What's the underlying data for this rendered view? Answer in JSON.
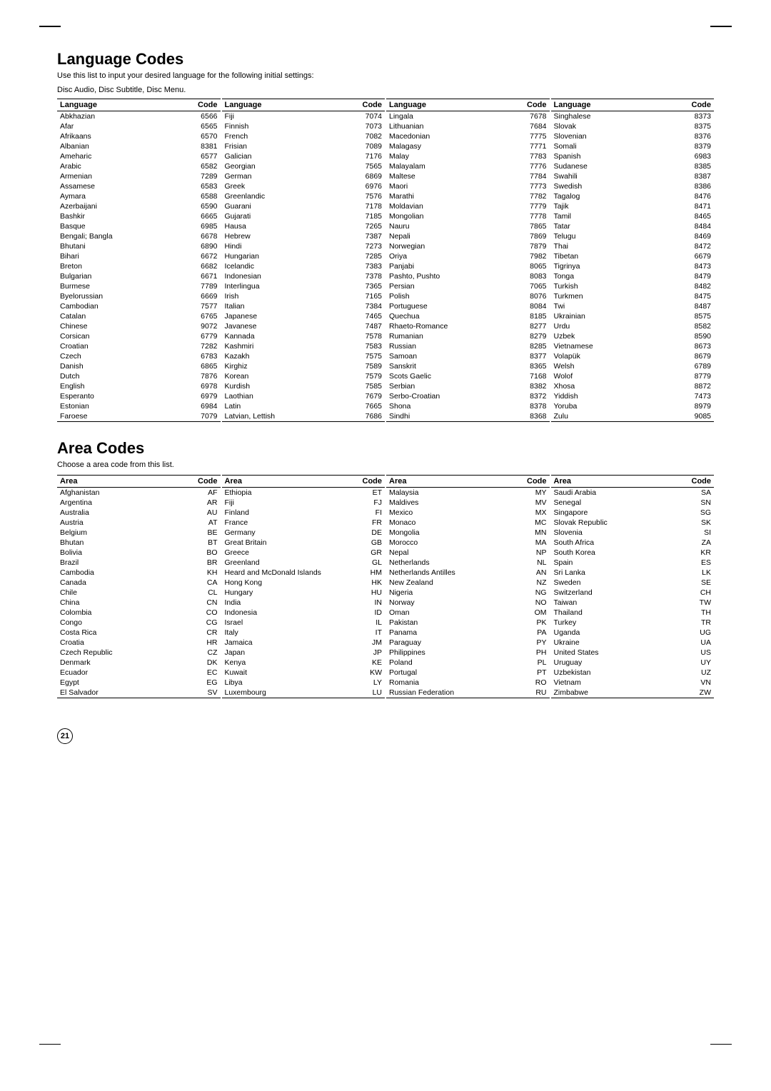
{
  "page": {
    "number": "21",
    "language_section": {
      "title": "Language Codes",
      "desc1": "Use this list to input your desired language for the following initial settings:",
      "desc2": "Disc Audio, Disc Subtitle, Disc Menu."
    },
    "area_section": {
      "title": "Area Codes",
      "desc": "Choose a area code from this list."
    }
  },
  "language_columns": [
    {
      "header_lang": "Language",
      "header_code": "Code",
      "rows": [
        [
          "Abkhazian",
          "6566"
        ],
        [
          "Afar",
          "6565"
        ],
        [
          "Afrikaans",
          "6570"
        ],
        [
          "Albanian",
          "8381"
        ],
        [
          "Ameharic",
          "6577"
        ],
        [
          "Arabic",
          "6582"
        ],
        [
          "Armenian",
          "7289"
        ],
        [
          "Assamese",
          "6583"
        ],
        [
          "Aymara",
          "6588"
        ],
        [
          "Azerbaijani",
          "6590"
        ],
        [
          "Bashkir",
          "6665"
        ],
        [
          "Basque",
          "6985"
        ],
        [
          "Bengali; Bangla",
          "6678"
        ],
        [
          "Bhutani",
          "6890"
        ],
        [
          "Bihari",
          "6672"
        ],
        [
          "Breton",
          "6682"
        ],
        [
          "Bulgarian",
          "6671"
        ],
        [
          "Burmese",
          "7789"
        ],
        [
          "Byelorussian",
          "6669"
        ],
        [
          "Cambodian",
          "7577"
        ],
        [
          "Catalan",
          "6765"
        ],
        [
          "Chinese",
          "9072"
        ],
        [
          "Corsican",
          "6779"
        ],
        [
          "Croatian",
          "7282"
        ],
        [
          "Czech",
          "6783"
        ],
        [
          "Danish",
          "6865"
        ],
        [
          "Dutch",
          "7876"
        ],
        [
          "English",
          "6978"
        ],
        [
          "Esperanto",
          "6979"
        ],
        [
          "Estonian",
          "6984"
        ],
        [
          "Faroese",
          "7079"
        ]
      ]
    },
    {
      "header_lang": "Language",
      "header_code": "Code",
      "rows": [
        [
          "Fiji",
          "7074"
        ],
        [
          "Finnish",
          "7073"
        ],
        [
          "French",
          "7082"
        ],
        [
          "Frisian",
          "7089"
        ],
        [
          "Galician",
          "7176"
        ],
        [
          "Georgian",
          "7565"
        ],
        [
          "German",
          "6869"
        ],
        [
          "Greek",
          "6976"
        ],
        [
          "Greenlandic",
          "7576"
        ],
        [
          "Guarani",
          "7178"
        ],
        [
          "Gujarati",
          "7185"
        ],
        [
          "Hausa",
          "7265"
        ],
        [
          "Hebrew",
          "7387"
        ],
        [
          "Hindi",
          "7273"
        ],
        [
          "Hungarian",
          "7285"
        ],
        [
          "Icelandic",
          "7383"
        ],
        [
          "Indonesian",
          "7378"
        ],
        [
          "Interlingua",
          "7365"
        ],
        [
          "Irish",
          "7165"
        ],
        [
          "Italian",
          "7384"
        ],
        [
          "Japanese",
          "7465"
        ],
        [
          "Javanese",
          "7487"
        ],
        [
          "Kannada",
          "7578"
        ],
        [
          "Kashmiri",
          "7583"
        ],
        [
          "Kazakh",
          "7575"
        ],
        [
          "Kirghiz",
          "7589"
        ],
        [
          "Korean",
          "7579"
        ],
        [
          "Kurdish",
          "7585"
        ],
        [
          "Laothian",
          "7679"
        ],
        [
          "Latin",
          "7665"
        ],
        [
          "Latvian, Lettish",
          "7686"
        ]
      ]
    },
    {
      "header_lang": "Language",
      "header_code": "Code",
      "rows": [
        [
          "Lingala",
          "7678"
        ],
        [
          "Lithuanian",
          "7684"
        ],
        [
          "Macedonian",
          "7775"
        ],
        [
          "Malagasy",
          "7771"
        ],
        [
          "Malay",
          "7783"
        ],
        [
          "Malayalam",
          "7776"
        ],
        [
          "Maltese",
          "7784"
        ],
        [
          "Maori",
          "7773"
        ],
        [
          "Marathi",
          "7782"
        ],
        [
          "Moldavian",
          "7779"
        ],
        [
          "Mongolian",
          "7778"
        ],
        [
          "Nauru",
          "7865"
        ],
        [
          "Nepali",
          "7869"
        ],
        [
          "Norwegian",
          "7879"
        ],
        [
          "Oriya",
          "7982"
        ],
        [
          "Panjabi",
          "8065"
        ],
        [
          "Pashto, Pushto",
          "8083"
        ],
        [
          "Persian",
          "7065"
        ],
        [
          "Polish",
          "8076"
        ],
        [
          "Portuguese",
          "8084"
        ],
        [
          "Quechua",
          "8185"
        ],
        [
          "Rhaeto-Romance",
          "8277"
        ],
        [
          "Rumanian",
          "8279"
        ],
        [
          "Russian",
          "8285"
        ],
        [
          "Samoan",
          "8377"
        ],
        [
          "Sanskrit",
          "8365"
        ],
        [
          "Scots Gaelic",
          "7168"
        ],
        [
          "Serbian",
          "8382"
        ],
        [
          "Serbo-Croatian",
          "8372"
        ],
        [
          "Shona",
          "8378"
        ],
        [
          "Sindhi",
          "8368"
        ]
      ]
    },
    {
      "header_lang": "Language",
      "header_code": "Code",
      "rows": [
        [
          "Singhalese",
          "8373"
        ],
        [
          "Slovak",
          "8375"
        ],
        [
          "Slovenian",
          "8376"
        ],
        [
          "Somali",
          "8379"
        ],
        [
          "Spanish",
          "6983"
        ],
        [
          "Sudanese",
          "8385"
        ],
        [
          "Swahili",
          "8387"
        ],
        [
          "Swedish",
          "8386"
        ],
        [
          "Tagalog",
          "8476"
        ],
        [
          "Tajik",
          "8471"
        ],
        [
          "Tamil",
          "8465"
        ],
        [
          "Tatar",
          "8484"
        ],
        [
          "Telugu",
          "8469"
        ],
        [
          "Thai",
          "8472"
        ],
        [
          "Tibetan",
          "6679"
        ],
        [
          "Tigrinya",
          "8473"
        ],
        [
          "Tonga",
          "8479"
        ],
        [
          "Turkish",
          "8482"
        ],
        [
          "Turkmen",
          "8475"
        ],
        [
          "Twi",
          "8487"
        ],
        [
          "Ukrainian",
          "8575"
        ],
        [
          "Urdu",
          "8582"
        ],
        [
          "Uzbek",
          "8590"
        ],
        [
          "Vietnamese",
          "8673"
        ],
        [
          "Volapük",
          "8679"
        ],
        [
          "Welsh",
          "6789"
        ],
        [
          "Wolof",
          "8779"
        ],
        [
          "Xhosa",
          "8872"
        ],
        [
          "Yiddish",
          "7473"
        ],
        [
          "Yoruba",
          "8979"
        ],
        [
          "Zulu",
          "9085"
        ]
      ]
    }
  ],
  "area_columns": [
    {
      "header_area": "Area",
      "header_code": "Code",
      "rows": [
        [
          "Afghanistan",
          "AF"
        ],
        [
          "Argentina",
          "AR"
        ],
        [
          "Australia",
          "AU"
        ],
        [
          "Austria",
          "AT"
        ],
        [
          "Belgium",
          "BE"
        ],
        [
          "Bhutan",
          "BT"
        ],
        [
          "Bolivia",
          "BO"
        ],
        [
          "Brazil",
          "BR"
        ],
        [
          "Cambodia",
          "KH"
        ],
        [
          "Canada",
          "CA"
        ],
        [
          "Chile",
          "CL"
        ],
        [
          "China",
          "CN"
        ],
        [
          "Colombia",
          "CO"
        ],
        [
          "Congo",
          "CG"
        ],
        [
          "Costa Rica",
          "CR"
        ],
        [
          "Croatia",
          "HR"
        ],
        [
          "Czech Republic",
          "CZ"
        ],
        [
          "Denmark",
          "DK"
        ],
        [
          "Ecuador",
          "EC"
        ],
        [
          "Egypt",
          "EG"
        ],
        [
          "El Salvador",
          "SV"
        ]
      ]
    },
    {
      "header_area": "Area",
      "header_code": "Code",
      "rows": [
        [
          "Ethiopia",
          "ET"
        ],
        [
          "Fiji",
          "FJ"
        ],
        [
          "Finland",
          "FI"
        ],
        [
          "France",
          "FR"
        ],
        [
          "Germany",
          "DE"
        ],
        [
          "Great Britain",
          "GB"
        ],
        [
          "Greece",
          "GR"
        ],
        [
          "Greenland",
          "GL"
        ],
        [
          "Heard and McDonald Islands",
          "HM"
        ],
        [
          "Hong Kong",
          "HK"
        ],
        [
          "Hungary",
          "HU"
        ],
        [
          "India",
          "IN"
        ],
        [
          "Indonesia",
          "ID"
        ],
        [
          "Israel",
          "IL"
        ],
        [
          "Italy",
          "IT"
        ],
        [
          "Jamaica",
          "JM"
        ],
        [
          "Japan",
          "JP"
        ],
        [
          "Kenya",
          "KE"
        ],
        [
          "Kuwait",
          "KW"
        ],
        [
          "Libya",
          "LY"
        ],
        [
          "Luxembourg",
          "LU"
        ]
      ]
    },
    {
      "header_area": "Area",
      "header_code": "Code",
      "rows": [
        [
          "Malaysia",
          "MY"
        ],
        [
          "Maldives",
          "MV"
        ],
        [
          "Mexico",
          "MX"
        ],
        [
          "Monaco",
          "MC"
        ],
        [
          "Mongolia",
          "MN"
        ],
        [
          "Morocco",
          "MA"
        ],
        [
          "Nepal",
          "NP"
        ],
        [
          "Netherlands",
          "NL"
        ],
        [
          "Netherlands Antilles",
          "AN"
        ],
        [
          "New Zealand",
          "NZ"
        ],
        [
          "Nigeria",
          "NG"
        ],
        [
          "Norway",
          "NO"
        ],
        [
          "Oman",
          "OM"
        ],
        [
          "Pakistan",
          "PK"
        ],
        [
          "Panama",
          "PA"
        ],
        [
          "Paraguay",
          "PY"
        ],
        [
          "Philippines",
          "PH"
        ],
        [
          "Poland",
          "PL"
        ],
        [
          "Portugal",
          "PT"
        ],
        [
          "Romania",
          "RO"
        ],
        [
          "Russian Federation",
          "RU"
        ]
      ]
    },
    {
      "header_area": "Area",
      "header_code": "Code",
      "rows": [
        [
          "Saudi Arabia",
          "SA"
        ],
        [
          "Senegal",
          "SN"
        ],
        [
          "Singapore",
          "SG"
        ],
        [
          "Slovak Republic",
          "SK"
        ],
        [
          "Slovenia",
          "SI"
        ],
        [
          "South Africa",
          "ZA"
        ],
        [
          "South Korea",
          "KR"
        ],
        [
          "Spain",
          "ES"
        ],
        [
          "Sri Lanka",
          "LK"
        ],
        [
          "Sweden",
          "SE"
        ],
        [
          "Switzerland",
          "CH"
        ],
        [
          "Taiwan",
          "TW"
        ],
        [
          "Thailand",
          "TH"
        ],
        [
          "Turkey",
          "TR"
        ],
        [
          "Uganda",
          "UG"
        ],
        [
          "Ukraine",
          "UA"
        ],
        [
          "United States",
          "US"
        ],
        [
          "Uruguay",
          "UY"
        ],
        [
          "Uzbekistan",
          "UZ"
        ],
        [
          "Vietnam",
          "VN"
        ],
        [
          "Zimbabwe",
          "ZW"
        ]
      ]
    }
  ]
}
